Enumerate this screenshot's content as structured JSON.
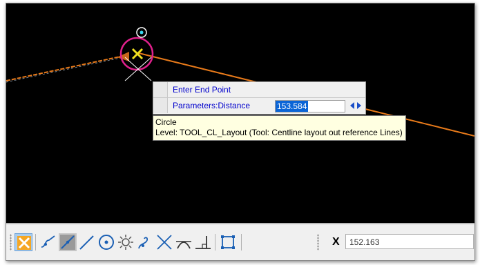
{
  "prompt": {
    "title": "Enter End Point",
    "param_label": "Parameters:Distance",
    "param_value": "153.584"
  },
  "tooltip": {
    "line1": "Circle",
    "line2": "Level: TOOL_CL_Layout (Tool: Centline layout out reference Lines)"
  },
  "toolbar": {
    "snaps": [
      "keypoint-snap-icon",
      "nearest-snap-icon",
      "midpoint-snap-icon",
      "center-snap-icon",
      "origin-snap-icon",
      "bisector-snap-icon",
      "intersection-snap-icon",
      "tangent-snap-icon",
      "perpendicular-snap-icon",
      "point-on-snap-icon"
    ],
    "x_label": "X",
    "x_value": "152.163"
  },
  "colors": {
    "canvas_bg": "#000000",
    "line_orange": "#e87a1a",
    "circle_magenta": "#e0208c",
    "cursor_yellow": "#f0e020",
    "prompt_text": "#0000cc",
    "tooltip_bg": "#ffffe1"
  }
}
